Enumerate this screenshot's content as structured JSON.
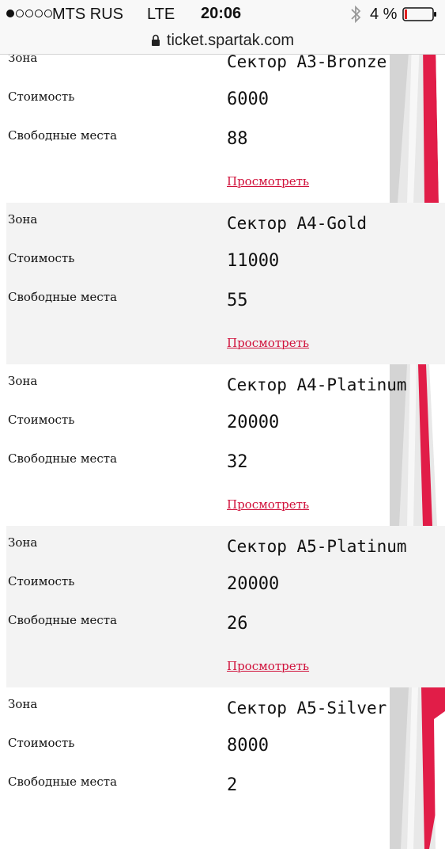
{
  "status_bar": {
    "carrier": "MTS RUS",
    "network": "LTE",
    "time": "20:06",
    "battery": "4 %",
    "signal_filled": 1,
    "signal_total": 5
  },
  "browser": {
    "url": "ticket.spartak.com"
  },
  "labels": {
    "zone": "Зона",
    "price": "Стоимость",
    "free_seats": "Свободные места",
    "view": "Просмотреть"
  },
  "sectors": [
    {
      "zone": "Сектор A3-Bronze",
      "price": "6000",
      "free_seats": "88"
    },
    {
      "zone": "Сектор A4-Gold",
      "price": "11000",
      "free_seats": "55"
    },
    {
      "zone": "Сектор A4-Platinum",
      "price": "20000",
      "free_seats": "32"
    },
    {
      "zone": "Сектор A5-Platinum",
      "price": "20000",
      "free_seats": "26"
    },
    {
      "zone": "Сектор A5-Silver",
      "price": "8000",
      "free_seats": "2"
    }
  ],
  "colors": {
    "link": "#d0103a",
    "alt_row": "#f3f3f3",
    "accent_red": "#e11d48"
  }
}
